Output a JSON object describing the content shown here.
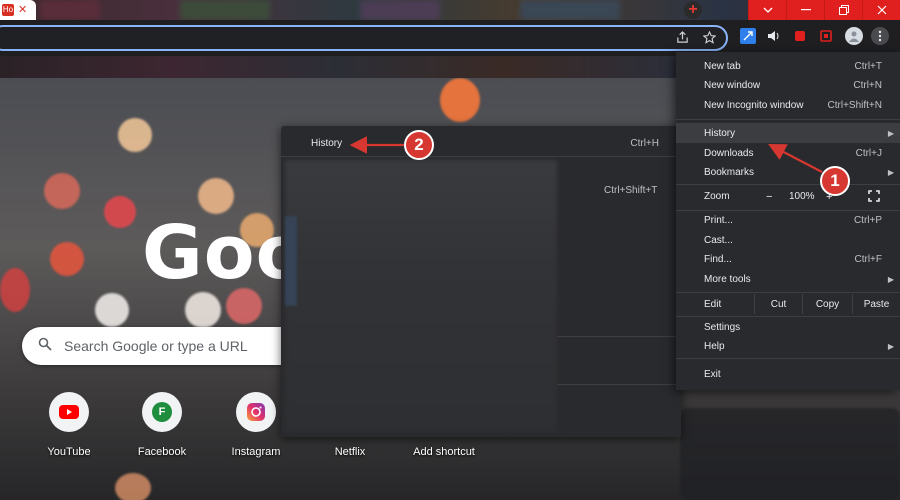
{
  "tabstrip": {
    "active_tab_title": "Ho",
    "active_tab_close": "✕",
    "new_tab_glyph": "+",
    "window_controls": [
      "chevron-down-icon",
      "minimize-icon",
      "restore-icon",
      "close-icon"
    ]
  },
  "page": {
    "logo_text": "Goo",
    "search_placeholder": "Search Google or type a URL",
    "shortcuts": [
      {
        "label": "YouTube",
        "icon": "youtube-icon"
      },
      {
        "label": "Facebook",
        "icon": "facebook-icon",
        "glyph": "F"
      },
      {
        "label": "Instagram",
        "icon": "instagram-icon"
      },
      {
        "label": "Netflix",
        "icon": "netflix-icon"
      },
      {
        "label": "Add shortcut",
        "icon": "plus-icon"
      }
    ]
  },
  "history_submenu": {
    "title": "History",
    "title_shortcut": "Ctrl+H",
    "partial_shortcut": "Ctrl+Shift+T"
  },
  "menu": {
    "new_tab": {
      "label": "New tab",
      "shortcut": "Ctrl+T"
    },
    "new_window": {
      "label": "New window",
      "shortcut": "Ctrl+N"
    },
    "new_incognito": {
      "label": "New Incognito window",
      "shortcut": "Ctrl+Shift+N"
    },
    "history": {
      "label": "History"
    },
    "downloads": {
      "label": "Downloads",
      "shortcut": "Ctrl+J"
    },
    "bookmarks": {
      "label": "Bookmarks"
    },
    "zoom": {
      "label": "Zoom",
      "minus": "−",
      "level": "100%",
      "plus": "+"
    },
    "print": {
      "label": "Print...",
      "shortcut": "Ctrl+P"
    },
    "cast": {
      "label": "Cast..."
    },
    "find": {
      "label": "Find...",
      "shortcut": "Ctrl+F"
    },
    "more_tools": {
      "label": "More tools"
    },
    "edit": {
      "label": "Edit",
      "cut": "Cut",
      "copy": "Copy",
      "paste": "Paste"
    },
    "settings": {
      "label": "Settings"
    },
    "help": {
      "label": "Help"
    },
    "exit": {
      "label": "Exit"
    }
  },
  "annotations": {
    "step1": "1",
    "step2": "2",
    "color": "#d63831"
  }
}
